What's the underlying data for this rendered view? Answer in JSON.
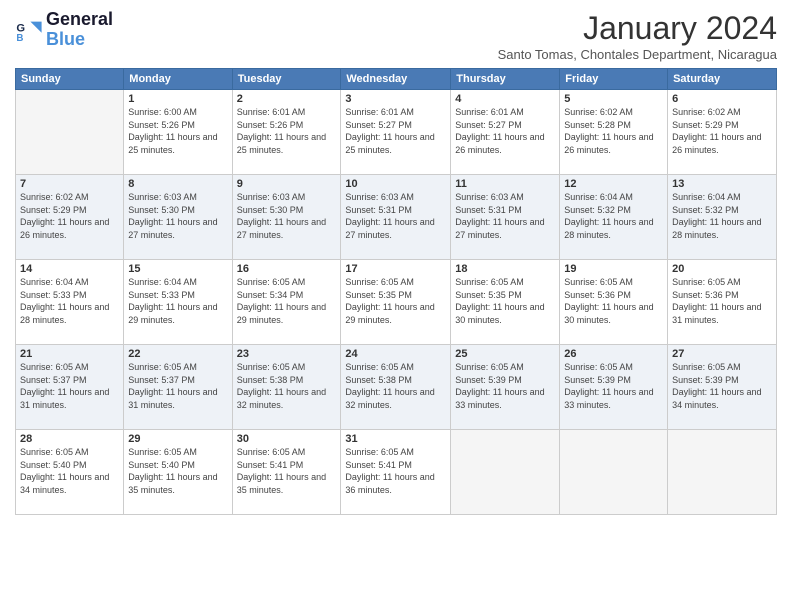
{
  "logo": {
    "general": "General",
    "blue": "Blue"
  },
  "title": "January 2024",
  "subtitle": "Santo Tomas, Chontales Department, Nicaragua",
  "weekdays": [
    "Sunday",
    "Monday",
    "Tuesday",
    "Wednesday",
    "Thursday",
    "Friday",
    "Saturday"
  ],
  "weeks": [
    [
      {
        "day": "",
        "empty": true
      },
      {
        "day": "1",
        "sunrise": "Sunrise: 6:00 AM",
        "sunset": "Sunset: 5:26 PM",
        "daylight": "Daylight: 11 hours and 25 minutes."
      },
      {
        "day": "2",
        "sunrise": "Sunrise: 6:01 AM",
        "sunset": "Sunset: 5:26 PM",
        "daylight": "Daylight: 11 hours and 25 minutes."
      },
      {
        "day": "3",
        "sunrise": "Sunrise: 6:01 AM",
        "sunset": "Sunset: 5:27 PM",
        "daylight": "Daylight: 11 hours and 25 minutes."
      },
      {
        "day": "4",
        "sunrise": "Sunrise: 6:01 AM",
        "sunset": "Sunset: 5:27 PM",
        "daylight": "Daylight: 11 hours and 26 minutes."
      },
      {
        "day": "5",
        "sunrise": "Sunrise: 6:02 AM",
        "sunset": "Sunset: 5:28 PM",
        "daylight": "Daylight: 11 hours and 26 minutes."
      },
      {
        "day": "6",
        "sunrise": "Sunrise: 6:02 AM",
        "sunset": "Sunset: 5:29 PM",
        "daylight": "Daylight: 11 hours and 26 minutes."
      }
    ],
    [
      {
        "day": "7",
        "sunrise": "Sunrise: 6:02 AM",
        "sunset": "Sunset: 5:29 PM",
        "daylight": "Daylight: 11 hours and 26 minutes."
      },
      {
        "day": "8",
        "sunrise": "Sunrise: 6:03 AM",
        "sunset": "Sunset: 5:30 PM",
        "daylight": "Daylight: 11 hours and 27 minutes."
      },
      {
        "day": "9",
        "sunrise": "Sunrise: 6:03 AM",
        "sunset": "Sunset: 5:30 PM",
        "daylight": "Daylight: 11 hours and 27 minutes."
      },
      {
        "day": "10",
        "sunrise": "Sunrise: 6:03 AM",
        "sunset": "Sunset: 5:31 PM",
        "daylight": "Daylight: 11 hours and 27 minutes."
      },
      {
        "day": "11",
        "sunrise": "Sunrise: 6:03 AM",
        "sunset": "Sunset: 5:31 PM",
        "daylight": "Daylight: 11 hours and 27 minutes."
      },
      {
        "day": "12",
        "sunrise": "Sunrise: 6:04 AM",
        "sunset": "Sunset: 5:32 PM",
        "daylight": "Daylight: 11 hours and 28 minutes."
      },
      {
        "day": "13",
        "sunrise": "Sunrise: 6:04 AM",
        "sunset": "Sunset: 5:32 PM",
        "daylight": "Daylight: 11 hours and 28 minutes."
      }
    ],
    [
      {
        "day": "14",
        "sunrise": "Sunrise: 6:04 AM",
        "sunset": "Sunset: 5:33 PM",
        "daylight": "Daylight: 11 hours and 28 minutes."
      },
      {
        "day": "15",
        "sunrise": "Sunrise: 6:04 AM",
        "sunset": "Sunset: 5:33 PM",
        "daylight": "Daylight: 11 hours and 29 minutes."
      },
      {
        "day": "16",
        "sunrise": "Sunrise: 6:05 AM",
        "sunset": "Sunset: 5:34 PM",
        "daylight": "Daylight: 11 hours and 29 minutes."
      },
      {
        "day": "17",
        "sunrise": "Sunrise: 6:05 AM",
        "sunset": "Sunset: 5:35 PM",
        "daylight": "Daylight: 11 hours and 29 minutes."
      },
      {
        "day": "18",
        "sunrise": "Sunrise: 6:05 AM",
        "sunset": "Sunset: 5:35 PM",
        "daylight": "Daylight: 11 hours and 30 minutes."
      },
      {
        "day": "19",
        "sunrise": "Sunrise: 6:05 AM",
        "sunset": "Sunset: 5:36 PM",
        "daylight": "Daylight: 11 hours and 30 minutes."
      },
      {
        "day": "20",
        "sunrise": "Sunrise: 6:05 AM",
        "sunset": "Sunset: 5:36 PM",
        "daylight": "Daylight: 11 hours and 31 minutes."
      }
    ],
    [
      {
        "day": "21",
        "sunrise": "Sunrise: 6:05 AM",
        "sunset": "Sunset: 5:37 PM",
        "daylight": "Daylight: 11 hours and 31 minutes."
      },
      {
        "day": "22",
        "sunrise": "Sunrise: 6:05 AM",
        "sunset": "Sunset: 5:37 PM",
        "daylight": "Daylight: 11 hours and 31 minutes."
      },
      {
        "day": "23",
        "sunrise": "Sunrise: 6:05 AM",
        "sunset": "Sunset: 5:38 PM",
        "daylight": "Daylight: 11 hours and 32 minutes."
      },
      {
        "day": "24",
        "sunrise": "Sunrise: 6:05 AM",
        "sunset": "Sunset: 5:38 PM",
        "daylight": "Daylight: 11 hours and 32 minutes."
      },
      {
        "day": "25",
        "sunrise": "Sunrise: 6:05 AM",
        "sunset": "Sunset: 5:39 PM",
        "daylight": "Daylight: 11 hours and 33 minutes."
      },
      {
        "day": "26",
        "sunrise": "Sunrise: 6:05 AM",
        "sunset": "Sunset: 5:39 PM",
        "daylight": "Daylight: 11 hours and 33 minutes."
      },
      {
        "day": "27",
        "sunrise": "Sunrise: 6:05 AM",
        "sunset": "Sunset: 5:39 PM",
        "daylight": "Daylight: 11 hours and 34 minutes."
      }
    ],
    [
      {
        "day": "28",
        "sunrise": "Sunrise: 6:05 AM",
        "sunset": "Sunset: 5:40 PM",
        "daylight": "Daylight: 11 hours and 34 minutes."
      },
      {
        "day": "29",
        "sunrise": "Sunrise: 6:05 AM",
        "sunset": "Sunset: 5:40 PM",
        "daylight": "Daylight: 11 hours and 35 minutes."
      },
      {
        "day": "30",
        "sunrise": "Sunrise: 6:05 AM",
        "sunset": "Sunset: 5:41 PM",
        "daylight": "Daylight: 11 hours and 35 minutes."
      },
      {
        "day": "31",
        "sunrise": "Sunrise: 6:05 AM",
        "sunset": "Sunset: 5:41 PM",
        "daylight": "Daylight: 11 hours and 36 minutes."
      },
      {
        "day": "",
        "empty": true
      },
      {
        "day": "",
        "empty": true
      },
      {
        "day": "",
        "empty": true
      }
    ]
  ]
}
